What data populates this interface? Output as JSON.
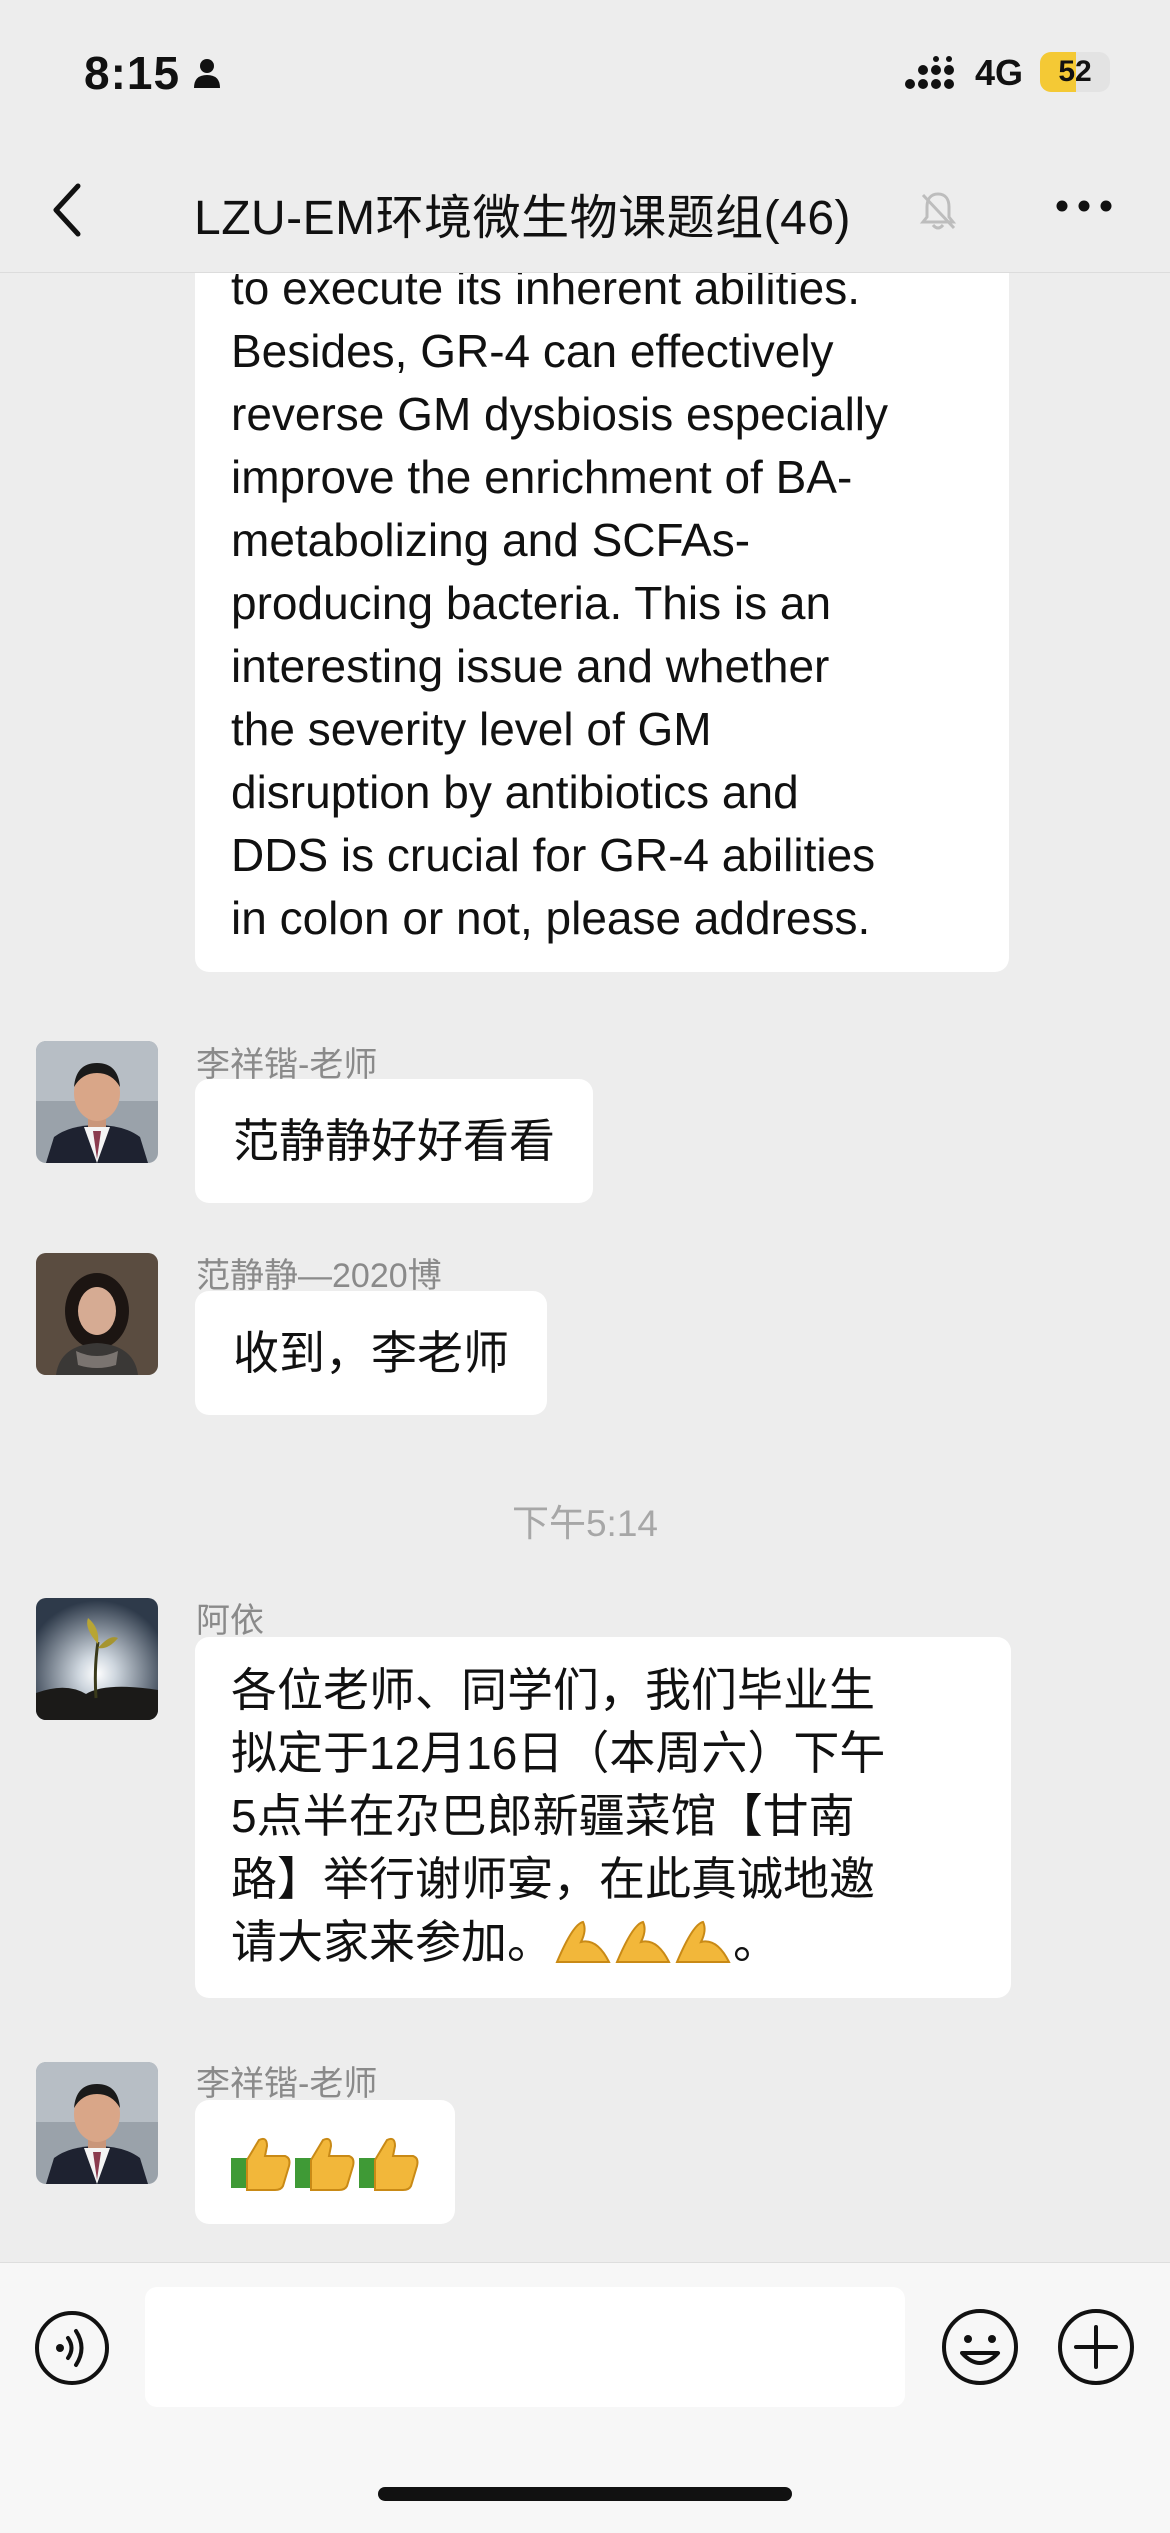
{
  "status_bar": {
    "time": "8:15",
    "network": "4G",
    "battery": "52",
    "battery_level_pct": 52
  },
  "nav": {
    "title": "LZU-EM环境微生物课题组(46)"
  },
  "messages": {
    "long_text": [
      "to execute its inherent abilities.",
      "Besides, GR-4 can effectively",
      "reverse GM dysbiosis especially",
      "improve the enrichment of BA-",
      "metabolizing and SCFAs-",
      "producing bacteria. This is an",
      "interesting issue and whether",
      "the severity level of GM",
      "disruption by antibiotics and",
      "DDS is crucial for GR-4 abilities",
      "in colon or not, please address."
    ],
    "m1": {
      "sender": "李祥锴-老师",
      "text": "范静静好好看看"
    },
    "m2": {
      "sender": "范静静—2020博",
      "text": "收到，李老师"
    },
    "timestamp": "下午5:14",
    "m3": {
      "sender": "阿依",
      "lines": [
        "各位老师、同学们，我们毕业生",
        "拟定于12月16日（本周六）下午",
        "5点半在尕巴郎新疆菜馆【甘南",
        "路】举行谢师宴，在此真诚地邀",
        "请大家来参加。"
      ],
      "tail": "。",
      "emoji": "pray-hands-emoji"
    },
    "m4": {
      "sender": "李祥锴-老师",
      "emoji": "thumbs-up-emoji"
    }
  },
  "icons": {
    "back": "chevron-left-icon",
    "mute": "bell-muted-icon",
    "more": "more-dots-icon",
    "voice": "voice-icon",
    "emoji": "smiley-icon",
    "plus": "plus-icon"
  },
  "colors": {
    "background": "#ededed",
    "bubble": "#ffffff",
    "battery": "#f4c935",
    "meta_text": "#8a8a8a"
  }
}
